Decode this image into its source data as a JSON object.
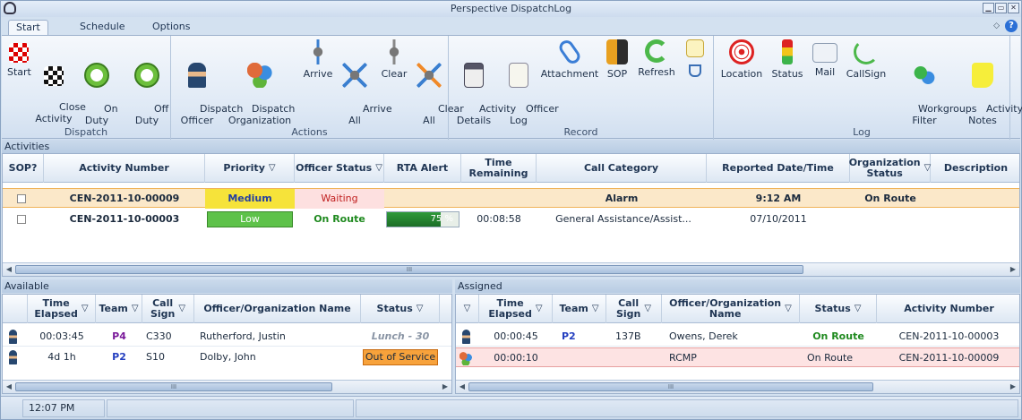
{
  "window": {
    "title": "Perspective DispatchLog"
  },
  "tabs": [
    {
      "label": "Start"
    },
    {
      "label": "Schedule"
    },
    {
      "label": "Options"
    }
  ],
  "ribbon": {
    "groups": [
      {
        "label": "Dispatch",
        "buttons": [
          "Start",
          "Close\nActivity",
          "On\nDuty",
          "Off\nDuty"
        ]
      },
      {
        "label": "Actions",
        "buttons": [
          "Dispatch\nOfficer",
          "Dispatch\nOrganization",
          "Arrive",
          "Arrive\nAll",
          "Clear",
          "Clear\nAll"
        ]
      },
      {
        "label": "Record",
        "buttons": [
          "Activity\nDetails",
          "Officer\nLog",
          "Attachment",
          "SOP",
          "Refresh"
        ]
      },
      {
        "label": "Log",
        "buttons": [
          "Location",
          "Status",
          "Mail",
          "CallSign",
          "Workgroups\nFilter",
          "Activity\nNotes"
        ]
      }
    ]
  },
  "activities": {
    "header": "Activities",
    "columns": [
      "SOP?",
      "Activity Number",
      "Priority",
      "Officer Status",
      "RTA Alert",
      "Time\nRemaining",
      "Call Category",
      "Reported Date/Time",
      "Organization\nStatus",
      "Description"
    ],
    "rows": [
      {
        "activity_number": "CEN-2011-10-00009",
        "priority": "Medium",
        "officer_status": "Waiting",
        "rta": "",
        "time_remaining": "",
        "call_category": "Alarm",
        "reported": "9:12 AM",
        "org_status": "On Route",
        "description": ""
      },
      {
        "activity_number": "CEN-2011-10-00003",
        "priority": "Low",
        "officer_status": "On Route",
        "rta": "75 %",
        "rta_fraction": 0.75,
        "time_remaining": "00:08:58",
        "call_category": "General Assistance/Assist...",
        "reported": "07/10/2011",
        "org_status": "",
        "description": ""
      }
    ],
    "scroll_mark": "III"
  },
  "available": {
    "header": "Available",
    "columns": [
      "Time\nElapsed",
      "Team",
      "Call\nSign",
      "Officer/Organization\nName",
      "Status"
    ],
    "rows": [
      {
        "elapsed": "00:03:45",
        "team": "P4",
        "callsign": "C330",
        "name": "Rutherford, Justin",
        "status": "Lunch - 30"
      },
      {
        "elapsed": "4d 1h",
        "team": "P2",
        "callsign": "S10",
        "name": "Dolby, John",
        "status": "Out of Service"
      }
    ],
    "scroll_mark": "III"
  },
  "assigned": {
    "header": "Assigned",
    "columns": [
      "Time\nElapsed",
      "Team",
      "Call\nSign",
      "Officer/Organization\nName",
      "Status",
      "Activity Number"
    ],
    "rows": [
      {
        "elapsed": "00:00:45",
        "team": "P2",
        "callsign": "137B",
        "name": "Owens, Derek",
        "status": "On Route",
        "activity": "CEN-2011-10-00003"
      },
      {
        "elapsed": "00:00:10",
        "team": "",
        "callsign": "",
        "name": "RCMP",
        "status": "On Route",
        "activity": "CEN-2011-10-00009"
      }
    ],
    "scroll_mark": "III"
  },
  "statusbar": {
    "time": "12:07 PM"
  },
  "colors": {
    "medium": "#f6e33a",
    "low": "#5ec24a",
    "waiting": "#fde0e0",
    "on_route": "#1f8a1f",
    "out_of_service": "#f7a23b",
    "selected_row": "#fbe8c9"
  }
}
